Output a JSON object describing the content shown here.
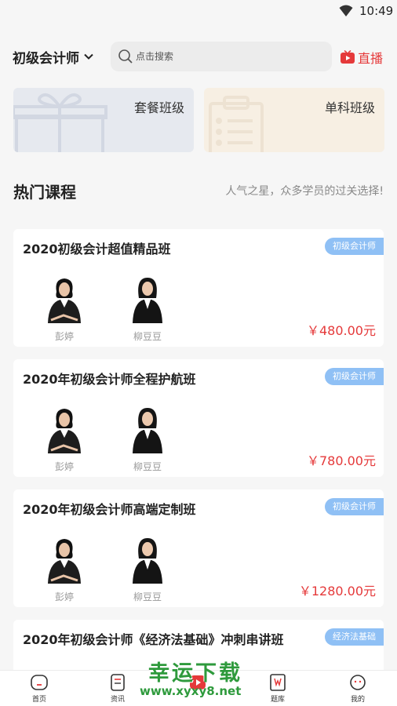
{
  "status_bar": {
    "time": "10:49",
    "wifi_icon": "wifi-icon"
  },
  "header": {
    "category": "初级会计师",
    "search_placeholder": "点击搜索",
    "live_label": "直播"
  },
  "class_cards": [
    {
      "label": "套餐班级",
      "icon": "gift-box-icon"
    },
    {
      "label": "单科班级",
      "icon": "clipboard-icon"
    }
  ],
  "section": {
    "title": "热门课程",
    "subtitle": "人气之星，众多学员的过关选择!"
  },
  "courses": [
    {
      "title": "2020初级会计超值精品班",
      "tag": "初级会计师",
      "teachers": [
        "彭婷",
        "柳豆豆"
      ],
      "price": "￥480.00元"
    },
    {
      "title": "2020年初级会计师全程护航班",
      "tag": "初级会计师",
      "teachers": [
        "彭婷",
        "柳豆豆"
      ],
      "price": "￥780.00元"
    },
    {
      "title": "2020年初级会计师高端定制班",
      "tag": "初级会计师",
      "teachers": [
        "彭婷",
        "柳豆豆"
      ],
      "price": "￥1280.00元"
    },
    {
      "title": "2020年初级会计师《经济法基础》冲刺串讲班",
      "tag": "经济法基础",
      "teachers": [],
      "price": ""
    }
  ],
  "bottom_nav": [
    {
      "label": "首页",
      "icon": "home-icon"
    },
    {
      "label": "资讯",
      "icon": "news-icon"
    },
    {
      "label": "",
      "icon": "play-icon"
    },
    {
      "label": "题库",
      "icon": "question-bank-icon"
    },
    {
      "label": "我的",
      "icon": "profile-icon"
    }
  ],
  "watermark": {
    "title": "幸运下载",
    "url": "www.xyxy8.net"
  },
  "colors": {
    "accent_red": "#e5393a",
    "tag_blue": "#8fc0f5",
    "watermark_green": "#2e9a3c"
  }
}
